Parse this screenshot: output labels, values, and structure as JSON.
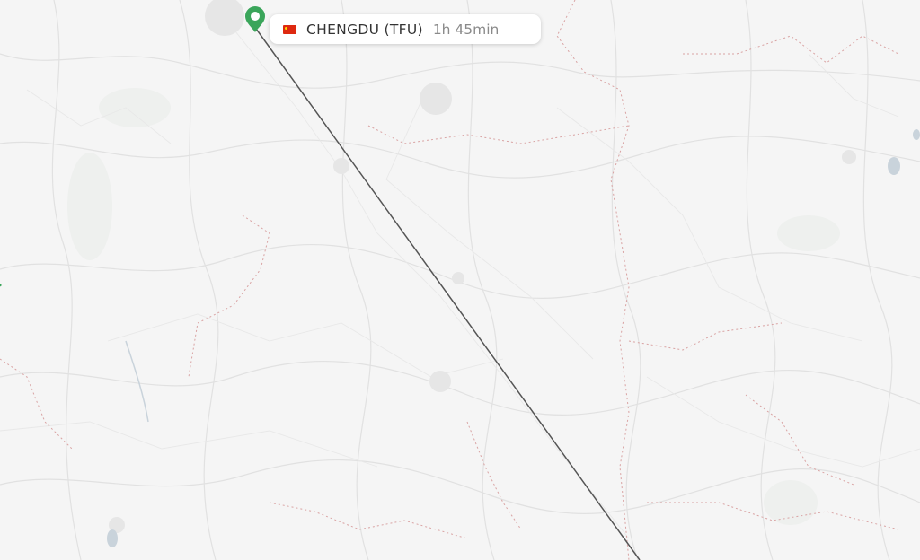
{
  "route_label": {
    "flag_icon": "china-flag-icon",
    "city": "CHENGDU (TFU)",
    "duration": "1h 45min"
  },
  "colors": {
    "background": "#f5f5f5",
    "road": "#e3e3e3",
    "border": "#d9a3a3",
    "water": "#c9d3db",
    "flight_path": "#555555",
    "marker": "#3aa55a"
  }
}
